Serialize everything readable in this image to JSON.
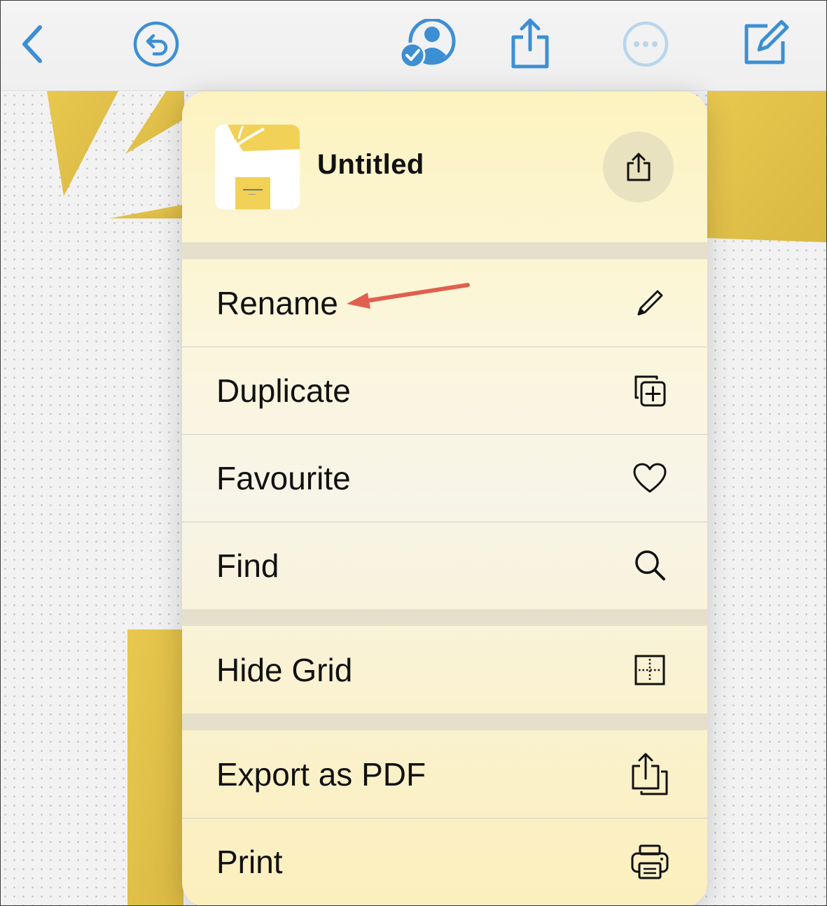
{
  "toolbar": {
    "icons": [
      "back-chevron-icon",
      "undo-icon",
      "collaboration-icon",
      "share-icon",
      "more-icon",
      "compose-icon"
    ],
    "accent_color": "#3d8fd4"
  },
  "menu": {
    "document": {
      "title": "Untitled",
      "thumbnail_icon": "board-thumbnail"
    },
    "header_action_icon": "share-icon",
    "groups": [
      [
        {
          "label": "Rename",
          "icon": "pencil-icon"
        },
        {
          "label": "Duplicate",
          "icon": "duplicate-icon"
        },
        {
          "label": "Favourite",
          "icon": "heart-icon"
        },
        {
          "label": "Find",
          "icon": "magnifier-icon"
        }
      ],
      [
        {
          "label": "Hide Grid",
          "icon": "grid-icon"
        }
      ],
      [
        {
          "label": "Export as PDF",
          "icon": "export-icon"
        },
        {
          "label": "Print",
          "icon": "printer-icon"
        }
      ]
    ]
  },
  "annotation": {
    "arrow_color": "#e0604f",
    "points_to": "Rename"
  },
  "colors": {
    "board_yellow": "#e3bf47",
    "menu_tint": "#fbf3cf"
  }
}
